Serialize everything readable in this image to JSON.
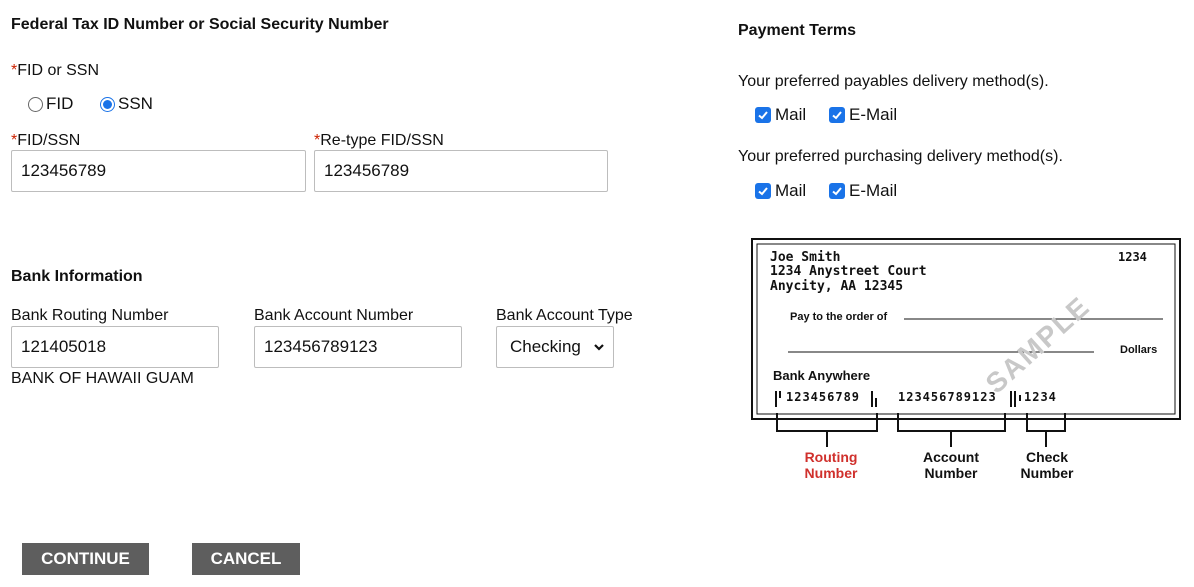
{
  "tax": {
    "title": "Federal Tax ID Number or Social Security Number",
    "fid_or_ssn_label": "FID or SSN",
    "required_mark": "*",
    "options": [
      "FID",
      "SSN"
    ],
    "selected": "SSN",
    "fid_ssn_label": "FID/SSN",
    "fid_ssn_value": "123456789",
    "retype_label": "Re-type FID/SSN",
    "retype_value": "123456789"
  },
  "bank": {
    "title": "Bank Information",
    "routing_label": "Bank Routing Number",
    "routing_value": "121405018",
    "bank_name": "BANK OF HAWAII GUAM",
    "account_label": "Bank Account Number",
    "account_value": "123456789123",
    "type_label": "Bank Account Type",
    "type_value": "Checking"
  },
  "payment": {
    "title": "Payment Terms",
    "payables_text": "Your preferred payables delivery method(s).",
    "payables_mail": "Mail",
    "payables_email": "E-Mail",
    "purchasing_text": "Your preferred purchasing delivery method(s).",
    "purchasing_mail": "Mail",
    "purchasing_email": "E-Mail"
  },
  "check": {
    "name": "Joe Smith",
    "address1": "1234 Anystreet Court",
    "address2": "Anycity, AA 12345",
    "number": "1234",
    "pay_to": "Pay to the order of",
    "dollars": "Dollars",
    "bank": "Bank Anywhere",
    "micr_routing": "123456789",
    "micr_account": "123456789123",
    "micr_check": "1234",
    "watermark": "SAMPLE",
    "routing_caption": [
      "Routing",
      "Number"
    ],
    "account_caption": [
      "Account",
      "Number"
    ],
    "check_caption": [
      "Check",
      "Number"
    ]
  },
  "buttons": {
    "continue": "CONTINUE",
    "cancel": "CANCEL"
  }
}
